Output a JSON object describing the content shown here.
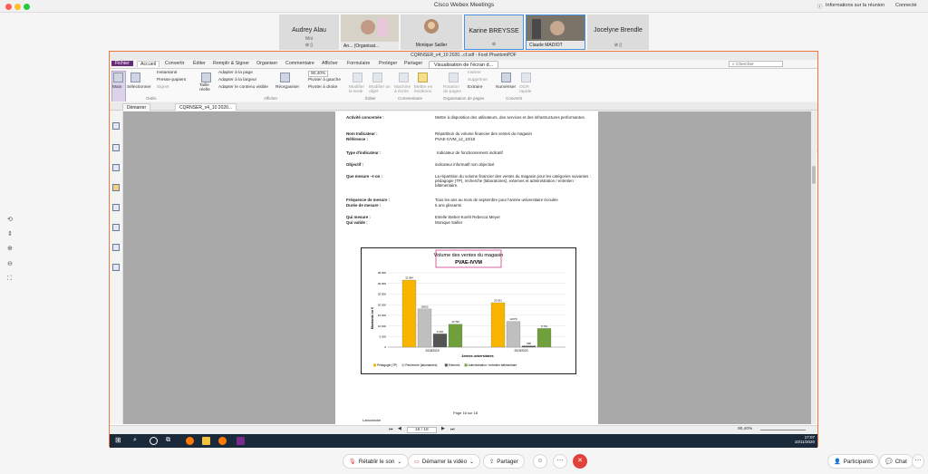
{
  "app": {
    "title": "Cisco Webex Meetings",
    "meeting_info": "Informations sur la réunion",
    "connection_status": "Connecté"
  },
  "participants": [
    {
      "name": "Audrey Alau",
      "sub": "Moi"
    },
    {
      "name": "An...",
      "sub": "(Organisat..."
    },
    {
      "name": "Monique Sailler",
      "sub": ""
    },
    {
      "name": "Karine BREYSSE",
      "sub": ""
    },
    {
      "name": "Claude MADIOT",
      "sub": ""
    },
    {
      "name": "Jocelyne Brendle",
      "sub": ""
    }
  ],
  "share": {
    "window_title": "CQRNSER_v4_10 2020...cf.sdf - Foxit PhantomPDF",
    "screen_share_label": "Visualisation de l'écran d...",
    "ribbon_tabs": [
      "Fichier",
      "Accueil",
      "Convertir",
      "Éditer",
      "Remplir & Signer",
      "Organiser",
      "Commentaire",
      "Afficher",
      "Formulaire",
      "Protéger",
      "Partager"
    ],
    "search_placeholder": "Chercher",
    "ribbon_items": {
      "main": "Main",
      "select": "Sélectionner",
      "snapshot": "Instantané",
      "clipboard": "Presse-papiers",
      "bookmark": "Signet",
      "actual_size": "Taille réelle",
      "fit_page": "Adapter à la page",
      "fit_width": "Adapter à la largeur",
      "fit_visible": "Adapter le contenu visible",
      "reflow": "Réorganiser",
      "zoom": "90,40%",
      "rotate_left": "Pivoter à gauche",
      "rotate_right": "Pivoter à droite",
      "edit_text": "Modifier le texte",
      "edit_object": "Modifier un objet",
      "typewriter": "Machine à écrire",
      "highlight": "Mettre en évidence",
      "rotate_pages": "Rotation de pages",
      "insert": "Insérer",
      "delete": "Supprimer",
      "extract": "Extraire",
      "scan": "Numériser",
      "ocr": "OCR rapide"
    },
    "ribbon_groups": [
      "Outils",
      "Afficher",
      "Éditer",
      "Commentaire",
      "Organisation de pages",
      "Convertir"
    ],
    "doc_tabs": [
      "Démarrer",
      "CQRNSER_v4_10 2020..."
    ],
    "page_nav": "16 / 18",
    "zoom_status": "90,40%",
    "taskbar_time": "17:07",
    "taskbar_date": "10/11/2020"
  },
  "document": {
    "fields": [
      {
        "label": "Activité concernée :",
        "value": "Mettre à disposition des utilisateurs, des services et des infrastructures performantes."
      },
      {
        "label": "Nom Indicateur :",
        "value": "Répartition du volume financier des ventes du magasin"
      },
      {
        "label": "Référence :",
        "value": "PVAE-IVVM_v2_10/19"
      },
      {
        "label": "Type d'indicateur :",
        "value": "Indicateur de fonctionnement indicatif"
      },
      {
        "label": "Objectif :",
        "value": "indicateur informatif non objectivé"
      },
      {
        "label": "Que mesure –t-on :",
        "value": "La répartition du volume financier des ventes du magasin pour les catégories suivantes : pédagogie (TP), recherche (laboratoires), externes et administration / entretien bâtimentaire."
      },
      {
        "label": "Fréquence de mesure :",
        "value": "Tous les ans au mois de septembre pour l'année universitaire écoulée"
      },
      {
        "label": "Durée de mesure :",
        "value": "5 ans glissants"
      },
      {
        "label": "Qui mesure :",
        "value": "Estelle Weber-Koehl Rebecca Meyer"
      },
      {
        "label": "Qui valide :",
        "value": "Monique Sailler"
      }
    ],
    "page_number": "Page 16 sur 18",
    "footer_left": "Laboratoire"
  },
  "chart_data": {
    "type": "bar",
    "title": "Volume des ventes du magasin",
    "subtitle": "PVAE-IVVM",
    "xlabel": "Années universitaires",
    "ylabel": "Montants en €",
    "categories": [
      "2018/2019",
      "2019/2020"
    ],
    "ylim": [
      0,
      35000
    ],
    "yticks": [
      0,
      5000,
      10000,
      15000,
      20000,
      25000,
      30000,
      35000
    ],
    "series": [
      {
        "name": "Pédagogie (TP)",
        "color": "#f7b500",
        "values": [
          31584,
          20921
        ]
      },
      {
        "name": "Recherche (laboratoires)",
        "color": "#bfbfbf",
        "values": [
          18020,
          12079
        ]
      },
      {
        "name": "Externes",
        "color": "#555555",
        "values": [
          6240,
          598
        ]
      },
      {
        "name": "Administration / entretien bâtimentaire",
        "color": "#70a03c",
        "values": [
          10796,
          8791
        ]
      }
    ],
    "data_labels": [
      [
        "31 584",
        "20 921"
      ],
      [
        "18020",
        "12079"
      ],
      [
        "6 240",
        "598"
      ],
      [
        "10 796",
        "8 791"
      ]
    ],
    "grid": true,
    "legend": "bottom"
  },
  "bottom": {
    "unmute": "Rétablir le son",
    "start_video": "Démarrer la vidéo",
    "share": "Partager",
    "participants": "Participants",
    "chat": "Chat"
  }
}
